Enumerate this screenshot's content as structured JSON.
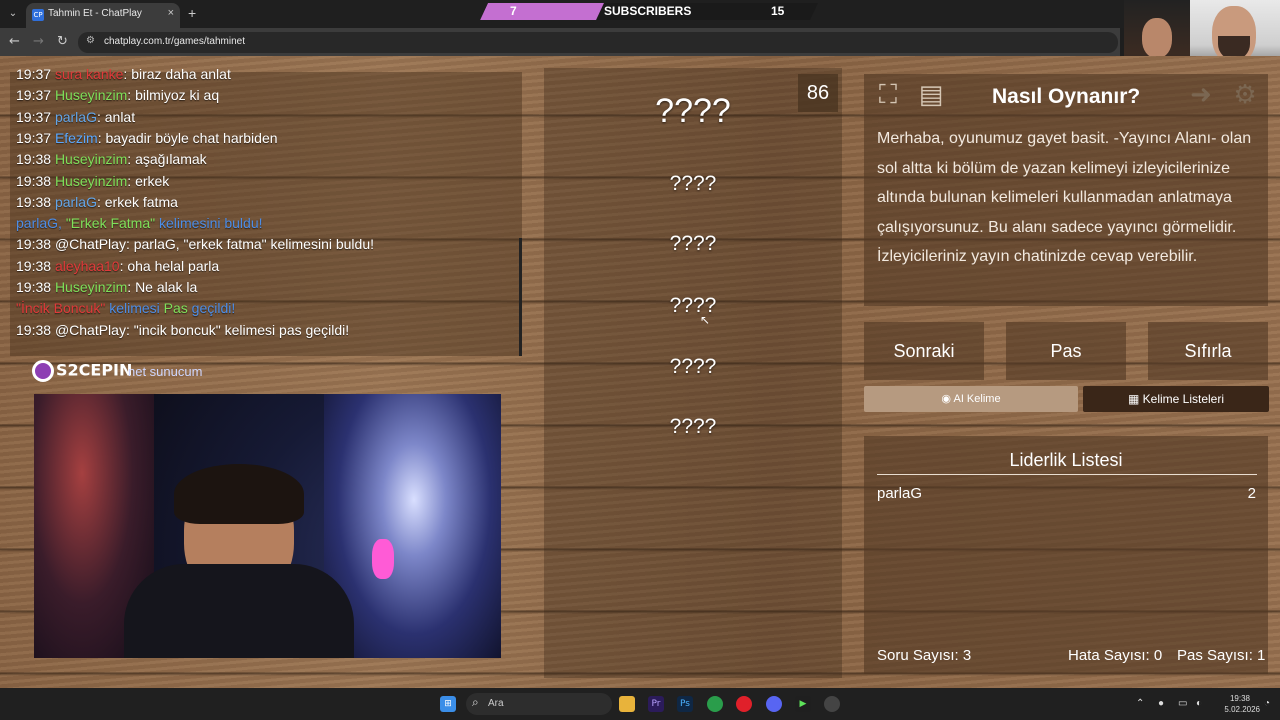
{
  "browser": {
    "tab_title": "Tahmin Et - ChatPlay",
    "tab_favicon_text": "CP",
    "url": "chatplay.com.tr/games/tahminet",
    "tab_close": "×",
    "new_tab": "+",
    "back": "←",
    "forward": "→",
    "reload": "↻"
  },
  "subscribers_bar": {
    "left_value": "7",
    "label": "SUBSCRIBERS",
    "right_value": "15",
    "progress": 0.35,
    "fill_color": "#c46fd1"
  },
  "chat": {
    "lines": [
      {
        "time": "19:37",
        "user": "sura kanke",
        "user_color": "red",
        "msg": ": biraz daha anlat"
      },
      {
        "time": "19:37",
        "user": "Huseyinzim",
        "user_color": "green",
        "msg": ": bilmiyoz ki aq"
      },
      {
        "time": "19:37",
        "user": "parlaG",
        "user_color": "lblue",
        "msg": ": anlat"
      },
      {
        "time": "19:37",
        "user": "Efezim",
        "user_color": "blue",
        "msg": ": bayadir böyle chat harbiden"
      },
      {
        "time": "19:38",
        "user": "Huseyinzim",
        "user_color": "green",
        "msg": ": aşağılamak"
      },
      {
        "time": "19:38",
        "user": "Huseyinzim",
        "user_color": "green",
        "msg": ": erkek"
      },
      {
        "time": "19:38",
        "user": "parlaG",
        "user_color": "lblue",
        "msg": ": erkek fatma"
      }
    ],
    "system_found": {
      "a": "parlaG, ",
      "b": "\"Erkek Fatma\"",
      "c": " kelimesini buldu!"
    },
    "bot_found": {
      "time": "19:38",
      "text": "@ChatPlay: parlaG, \"erkek fatma\" kelimesini buldu!"
    },
    "lines2": [
      {
        "time": "19:38",
        "user": "aleyhaa10",
        "user_color": "red",
        "msg": ": oha helal parla"
      },
      {
        "time": "19:38",
        "user": "Huseyinzim",
        "user_color": "green",
        "msg": ": Ne alak la"
      }
    ],
    "system_pass": {
      "a": "\"İncik Boncuk\"",
      "b": " kelimesi ",
      "c": "Pas",
      "d": " geçildi!"
    },
    "bot_pass": {
      "time": "19:38",
      "text": "@ChatPlay: \"incik boncuk\" kelimesi pas geçildi!"
    }
  },
  "sponsors": {
    "s2": "S2CEPIN",
    "net": "net sunucum"
  },
  "game": {
    "timer": "86",
    "words": [
      "????",
      "????",
      "????",
      "????",
      "????",
      "????"
    ]
  },
  "howto": {
    "title": "Nasıl Oynanır?",
    "text": "Merhaba, oyunumuz gayet basit. -Yayıncı Alanı- olan sol altta ki bölüm de yazan kelimeyi izleyicilerinize altında bulunan kelimeleri kullanmadan anlatmaya çalışıyorsunuz. Bu alanı sadece yayıncı görmelidir. İzleyicileriniz yayın chatinizde cevap verebilir."
  },
  "controls": {
    "next": "Sonraki",
    "pass": "Pas",
    "reset": "Sıfırla",
    "ai_word": "AI Kelime",
    "word_lists": "Kelime Listeleri"
  },
  "leaderboard": {
    "title": "Liderlik Listesi",
    "rows": [
      {
        "name": "parlaG",
        "score": "2"
      }
    ]
  },
  "stats": {
    "questions": "Soru Sayısı: 3",
    "errors": "Hata Sayısı: 0",
    "passes": "Pas Sayısı: 1"
  },
  "taskbar": {
    "search_placeholder": "Ara",
    "time": "19:38",
    "date": "5.02.2026"
  },
  "colors": {
    "chat_red": "#e03a3a",
    "chat_green": "#7fe05a",
    "chat_blue": "#5aa8ff",
    "system_blue": "#4d8de6"
  }
}
